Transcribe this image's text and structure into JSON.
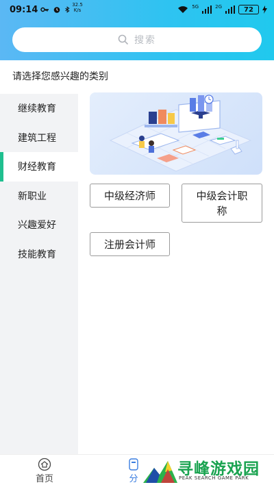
{
  "status_bar": {
    "time": "09:14",
    "speed_value": "32.5",
    "speed_unit": "K/s",
    "network_5g": "5G",
    "network_2g": "2G",
    "battery": "72"
  },
  "search": {
    "placeholder": "搜索"
  },
  "prompt": "请选择您感兴趣的类别",
  "sidebar": {
    "items": [
      {
        "label": "继续教育",
        "active": false
      },
      {
        "label": "建筑工程",
        "active": false
      },
      {
        "label": "财经教育",
        "active": true
      },
      {
        "label": "新职业",
        "active": false
      },
      {
        "label": "兴趣爱好",
        "active": false
      },
      {
        "label": "技能教育",
        "active": false
      }
    ]
  },
  "tags": [
    {
      "label": "中级经济师"
    },
    {
      "label": "中级会计职称"
    },
    {
      "label": "注册会计师"
    }
  ],
  "bottom_nav": {
    "items": [
      {
        "label": "首页",
        "icon": "home-icon"
      },
      {
        "label": "分",
        "icon": "category-icon"
      }
    ]
  },
  "watermark": {
    "title": "寻峰游戏园",
    "subtitle": "PEAK SEARCH GAME PARK"
  },
  "colors": {
    "header_start": "#5bb8f4",
    "header_end": "#20c9ee",
    "active_indicator": "#1fbf8f",
    "sidebar_bg": "#f2f3f5"
  }
}
